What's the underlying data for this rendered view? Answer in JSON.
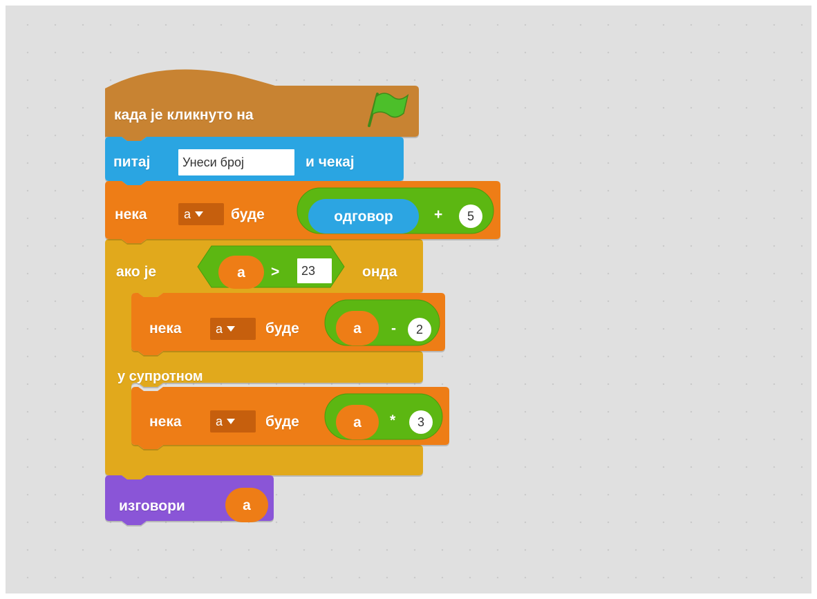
{
  "colors": {
    "workspace_bg": "#e0e0e0",
    "events": "#c88330",
    "sensing": "#2ca5e2",
    "data": "#ee7d16",
    "data_dark": "#c65f0d",
    "control": "#e1a91a",
    "operators": "#5cb712",
    "looks": "#8a55d7"
  },
  "script": {
    "hat": {
      "label": "када је кликнуто на",
      "icon": "green-flag-icon"
    },
    "ask": {
      "prefix": "питај",
      "prompt_value": "Унеси број",
      "suffix": "и чекај"
    },
    "set1": {
      "prefix": "нека",
      "variable": "a",
      "middle": "буде",
      "reporter": "одговор",
      "operator": "+",
      "number": "5"
    },
    "if_else": {
      "if_prefix": "ако је",
      "cond_var": "a",
      "cond_op": ">",
      "cond_value": "23",
      "then_label": "онда",
      "else_label": "у супротном"
    },
    "set2": {
      "prefix": "нека",
      "variable": "a",
      "middle": "буде",
      "reporter": "a",
      "operator": "-",
      "number": "2"
    },
    "set3": {
      "prefix": "нека",
      "variable": "a",
      "middle": "буде",
      "reporter": "a",
      "operator": "*",
      "number": "3"
    },
    "say": {
      "label": "изговори",
      "reporter": "a"
    }
  }
}
